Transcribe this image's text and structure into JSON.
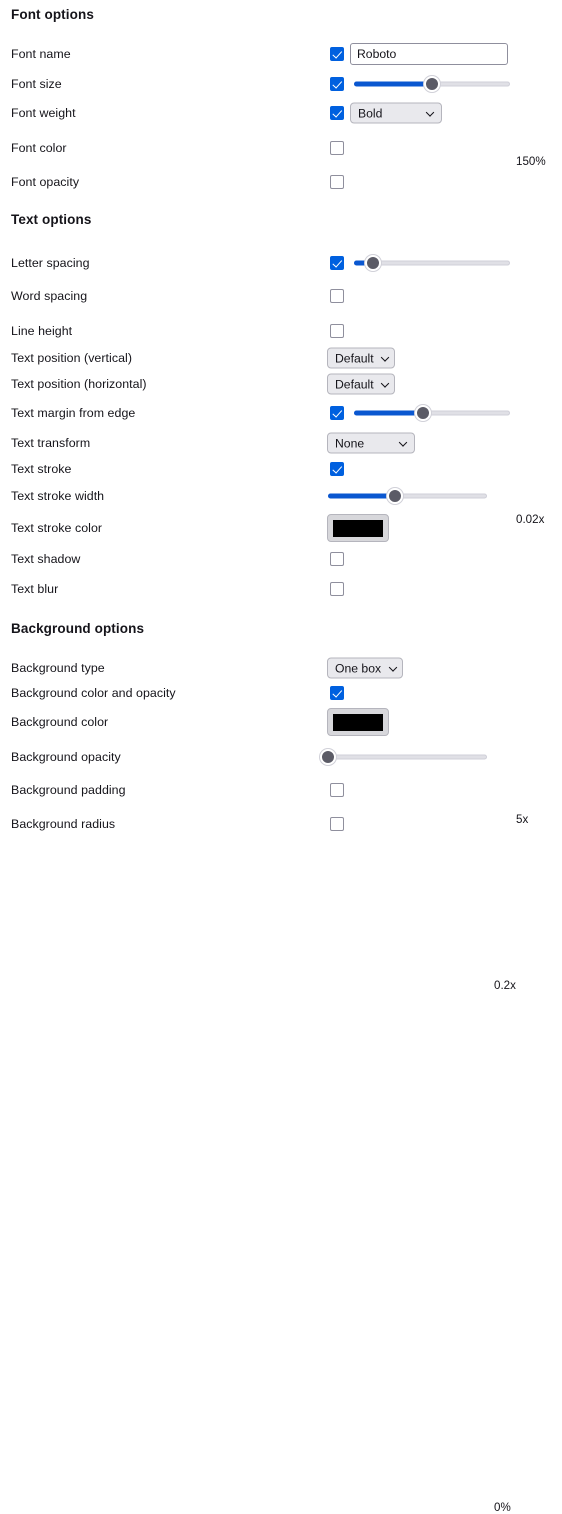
{
  "sections": [
    {
      "title": "Font options"
    },
    {
      "title": "Text options"
    },
    {
      "title": "Background options"
    }
  ],
  "rows": {
    "font_name": {
      "label": "Font name",
      "value": "Roboto",
      "placeholder": ""
    },
    "font_size": {
      "label": "Font size",
      "value": "150%"
    },
    "font_weight": {
      "label": "Font weight",
      "value": "Bold"
    },
    "font_color": {
      "label": "Font color"
    },
    "font_opacity": {
      "label": "Font opacity"
    },
    "letter_spacing": {
      "label": "Letter spacing",
      "value": "0.02x"
    },
    "word_spacing": {
      "label": "Word spacing"
    },
    "line_height": {
      "label": "Line height"
    },
    "text_pos_vert": {
      "label": "Text position (vertical)",
      "value": "Default"
    },
    "text_pos_horiz": {
      "label": "Text position (horizontal)",
      "value": "Default"
    },
    "text_margin": {
      "label": "Text margin from edge",
      "value": "5x"
    },
    "text_transform": {
      "label": "Text transform",
      "value": "None"
    },
    "text_stroke": {
      "label": "Text stroke"
    },
    "text_stroke_width": {
      "label": "Text stroke width",
      "value": "0.2x"
    },
    "text_stroke_color": {
      "label": "Text stroke color",
      "color": "#000000"
    },
    "text_shadow": {
      "label": "Text shadow"
    },
    "text_blur": {
      "label": "Text blur"
    },
    "bg_type": {
      "label": "Background type",
      "value": "One box"
    },
    "bg_color_opacity": {
      "label": "Background color and opacity"
    },
    "bg_color": {
      "label": "Background color",
      "color": "#000000"
    },
    "bg_opacity": {
      "label": "Background opacity",
      "value": "0%"
    },
    "bg_padding": {
      "label": "Background padding"
    },
    "bg_radius": {
      "label": "Background radius"
    }
  },
  "theme": {
    "accent": "#0060df",
    "slider_fill": "#0a57d0",
    "thumb": "#5b5b66",
    "control_bg": "#e9e9ed"
  }
}
